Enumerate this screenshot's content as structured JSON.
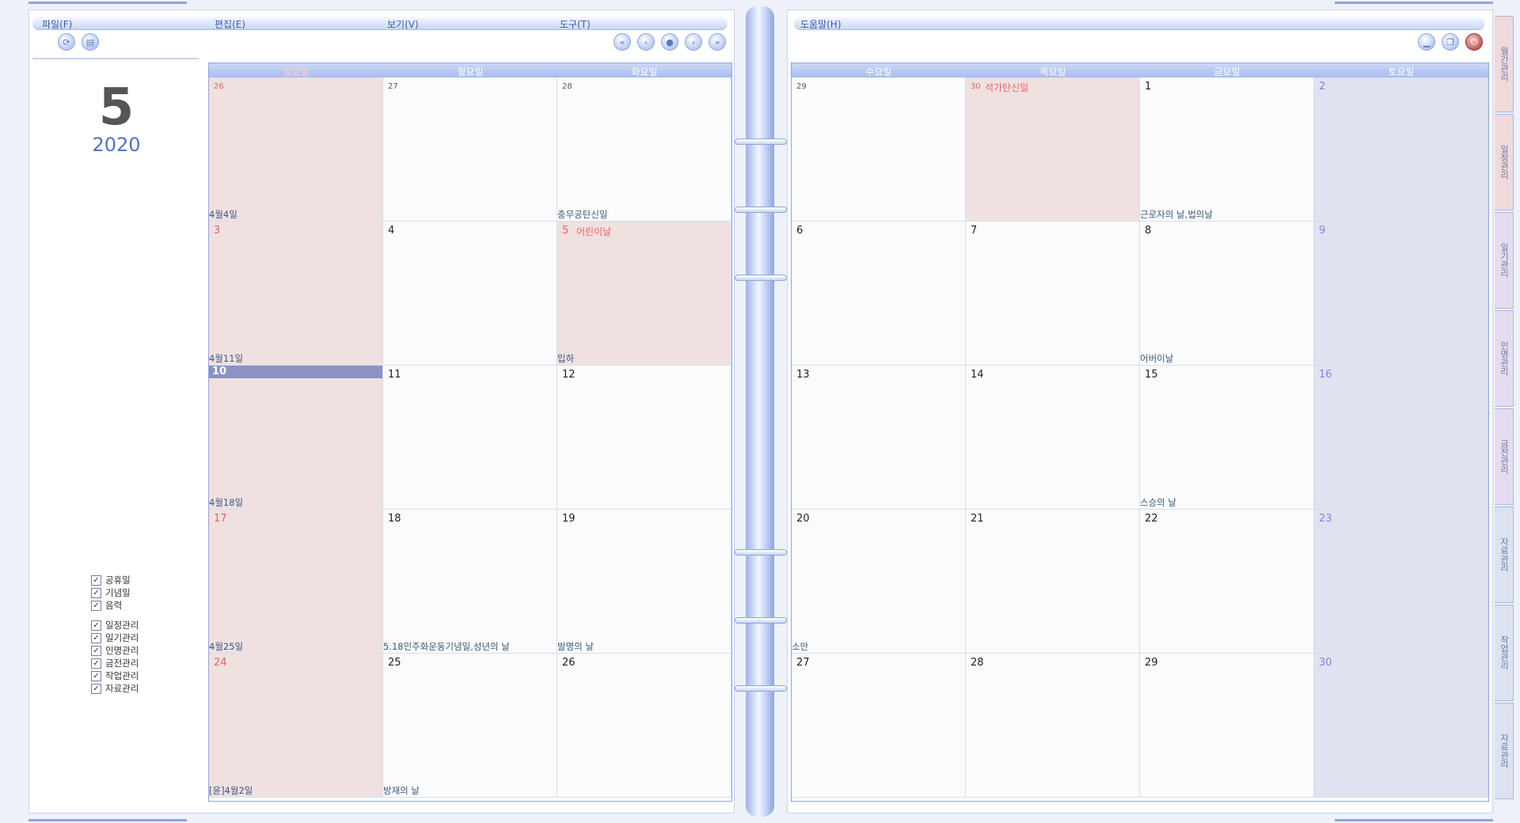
{
  "menu": {
    "file": "파일(F)",
    "edit": "편집(E)",
    "view": "보기(V)",
    "tools": "도구(T)",
    "help": "도움말(H)"
  },
  "month": "5",
  "year": "2020",
  "checkboxes": {
    "group1": [
      "공휴일",
      "기념일",
      "음력"
    ],
    "group2": [
      "일정관리",
      "일기관리",
      "인명관리",
      "금전관리",
      "작업관리",
      "자료관리"
    ]
  },
  "weekdays": [
    "일요일",
    "월요일",
    "화요일",
    "수요일",
    "목요일",
    "금요일",
    "토요일"
  ],
  "weeks": [
    [
      {
        "d": "26",
        "small": true,
        "note": "4월4일"
      },
      {
        "d": "27",
        "small": true
      },
      {
        "d": "28",
        "small": true,
        "note": "충무공탄신일"
      },
      {
        "d": "29",
        "small": true
      },
      {
        "d": "30",
        "small": true,
        "hol": "석가탄신일"
      },
      {
        "d": "1",
        "note": "근로자의 날,법의날"
      },
      {
        "d": "2"
      }
    ],
    [
      {
        "d": "3",
        "note": "4월11일"
      },
      {
        "d": "4"
      },
      {
        "d": "5",
        "hol": "어린이날",
        "note": "입하"
      },
      {
        "d": "6"
      },
      {
        "d": "7"
      },
      {
        "d": "8",
        "note": "어버이날"
      },
      {
        "d": "9"
      }
    ],
    [
      {
        "d": "10",
        "today": true,
        "note": "4월18일"
      },
      {
        "d": "11"
      },
      {
        "d": "12"
      },
      {
        "d": "13"
      },
      {
        "d": "14"
      },
      {
        "d": "15",
        "note": "스승의 날"
      },
      {
        "d": "16"
      }
    ],
    [
      {
        "d": "17",
        "note": "4월25일"
      },
      {
        "d": "18",
        "note": "5.18민주화운동기념일,성년의 날"
      },
      {
        "d": "19",
        "note": "발명의 날"
      },
      {
        "d": "20",
        "note": "소만"
      },
      {
        "d": "21"
      },
      {
        "d": "22"
      },
      {
        "d": "23"
      }
    ],
    [
      {
        "d": "24",
        "note": "[윤]4월2일"
      },
      {
        "d": "25",
        "note": "방재의 날"
      },
      {
        "d": "26"
      },
      {
        "d": "27"
      },
      {
        "d": "28"
      },
      {
        "d": "29"
      },
      {
        "d": "30"
      }
    ]
  ],
  "side_tabs": [
    "월간관리",
    "일정관리",
    "일기관리",
    "인명관리",
    "금전관리",
    "자료관리",
    "작업관리",
    "자료관리"
  ],
  "colors": {
    "accent": "#8ea6dd",
    "sunday": "#e06666",
    "saturday": "#7d86dd",
    "header": "#a9bdf0",
    "today": "#8a93c2"
  }
}
